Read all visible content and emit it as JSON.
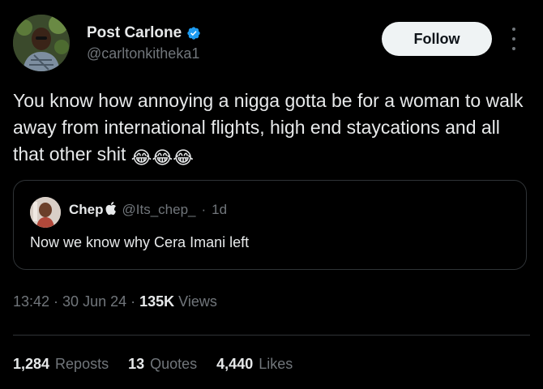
{
  "post": {
    "author": {
      "display_name": "Post Carlone",
      "handle": "@carltonkitheka1",
      "verified_icon": "verified-badge-icon",
      "avatar_icon": "avatar"
    },
    "follow_label": "Follow",
    "more_icon": "more-options-icon",
    "text": "You know how annoying a nigga gotta be for a woman to walk away from international flights, high end staycations and all that other shit",
    "emojis": [
      "😂",
      "😂",
      "😂"
    ],
    "quote": {
      "display_name": "Chep",
      "name_emoji": "",
      "handle": "@Its_chep_",
      "separator": "·",
      "time": "1d",
      "text": "Now we know why Cera Imani left"
    },
    "meta": {
      "time": "13:42",
      "sep1": "·",
      "date": "30 Jun 24",
      "sep2": "·",
      "views_count": "135K",
      "views_label": "Views"
    },
    "stats": [
      {
        "count": "1,284",
        "label": "Reposts"
      },
      {
        "count": "13",
        "label": "Quotes"
      },
      {
        "count": "4,440",
        "label": "Likes"
      }
    ]
  },
  "colors": {
    "background": "#000000",
    "text_primary": "#e7e9ea",
    "text_secondary": "#71767b",
    "border": "#2f3336",
    "follow_bg": "#eff3f4",
    "verified": "#1d9bf0"
  }
}
